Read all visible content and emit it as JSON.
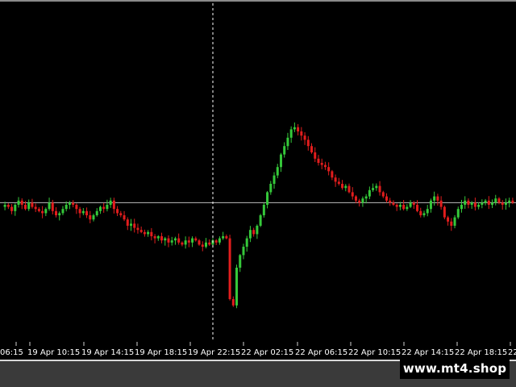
{
  "watermark": "www.mt4.shop",
  "colors": {
    "background": "#000000",
    "bull": "#35c93a",
    "bear": "#e21d1d",
    "grid_line": "#bdbdbd",
    "crosshair": "#ffffff",
    "text": "#ffffff"
  },
  "chart_data": {
    "type": "candlestick",
    "title": "",
    "xlabel": "",
    "ylabel": "",
    "grid": false,
    "price_axis_visible": false,
    "x_tick_labels": [
      "06:15",
      "19 Apr 10:15",
      "19 Apr 14:15",
      "19 Apr 18:15",
      "19 Apr 22:15",
      "22 Apr 02:15",
      "22 Apr 06:15",
      "22 Apr 10:15",
      "22 Apr 14:15",
      "22 Apr 18:15",
      "22"
    ],
    "reference_line_level": 0.61,
    "crosshair_at": "19 Apr 22:15",
    "y_range": [
      0.0,
      1.0
    ],
    "close_series": [
      0.6,
      0.59,
      0.57,
      0.6,
      0.62,
      0.6,
      0.58,
      0.61,
      0.59,
      0.58,
      0.57,
      0.56,
      0.58,
      0.61,
      0.57,
      0.55,
      0.56,
      0.58,
      0.6,
      0.61,
      0.6,
      0.58,
      0.56,
      0.57,
      0.55,
      0.53,
      0.55,
      0.57,
      0.59,
      0.58,
      0.6,
      0.62,
      0.58,
      0.56,
      0.55,
      0.53,
      0.5,
      0.51,
      0.49,
      0.48,
      0.47,
      0.46,
      0.47,
      0.45,
      0.44,
      0.45,
      0.43,
      0.44,
      0.42,
      0.43,
      0.44,
      0.42,
      0.41,
      0.43,
      0.42,
      0.44,
      0.43,
      0.41,
      0.4,
      0.42,
      0.41,
      0.43,
      0.42,
      0.44,
      0.45,
      0.44,
      0.15,
      0.12,
      0.3,
      0.36,
      0.4,
      0.44,
      0.48,
      0.46,
      0.5,
      0.55,
      0.6,
      0.66,
      0.7,
      0.74,
      0.78,
      0.84,
      0.88,
      0.92,
      0.96,
      0.97,
      0.95,
      0.93,
      0.91,
      0.88,
      0.85,
      0.82,
      0.8,
      0.79,
      0.78,
      0.76,
      0.73,
      0.71,
      0.7,
      0.68,
      0.69,
      0.66,
      0.64,
      0.62,
      0.61,
      0.63,
      0.64,
      0.67,
      0.68,
      0.69,
      0.66,
      0.64,
      0.62,
      0.61,
      0.6,
      0.59,
      0.6,
      0.58,
      0.59,
      0.61,
      0.6,
      0.57,
      0.55,
      0.56,
      0.58,
      0.62,
      0.64,
      0.62,
      0.59,
      0.54,
      0.52,
      0.5,
      0.54,
      0.58,
      0.6,
      0.62,
      0.6,
      0.61,
      0.59,
      0.6,
      0.61,
      0.62,
      0.6,
      0.61,
      0.63,
      0.61,
      0.6,
      0.61,
      0.62,
      0.61
    ]
  }
}
